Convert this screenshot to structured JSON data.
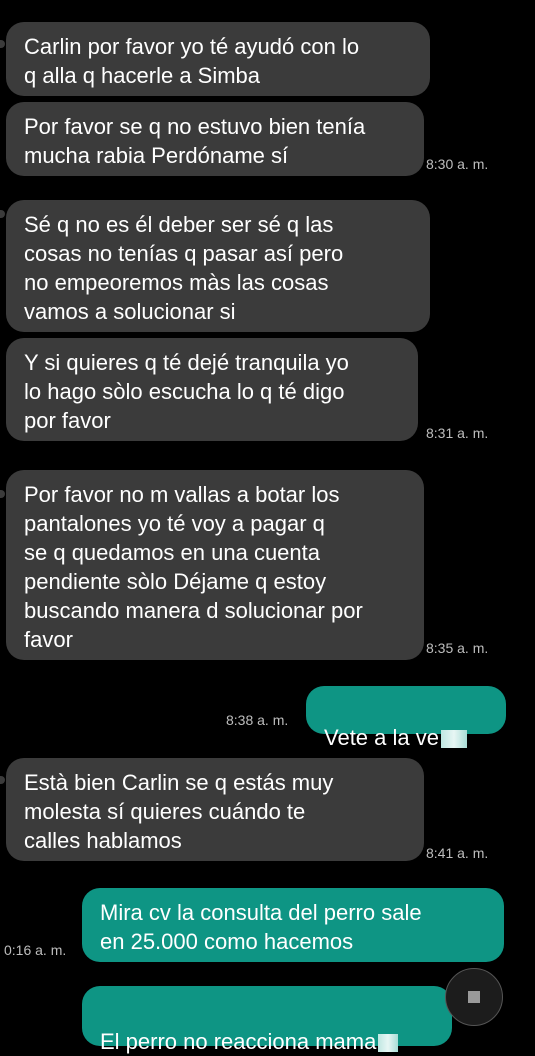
{
  "messages": [
    {
      "dir": "in",
      "text": "Carlin por favor yo té ayudó con lo\nq alla q hacerle a Simba"
    },
    {
      "dir": "in",
      "text": "Por favor se q no estuvo bien tenía\nmucha rabia Perdóname sí",
      "time": "8:30 a. m."
    },
    {
      "dir": "in",
      "text": "Sé q no es él deber ser sé q las\ncosas no tenías q pasar así pero\nno empeoremos màs las cosas\nvamos a solucionar si"
    },
    {
      "dir": "in",
      "text": "Y si quieres q té dejé tranquila yo\nlo hago sòlo escucha lo q té digo\npor favor",
      "time": "8:31 a. m."
    },
    {
      "dir": "in",
      "text": "Por favor no m vallas a botar los\npantalones yo té voy a pagar q\nse q quedamos en una cuenta\npendiente sòlo Déjame q estoy\nbuscando manera d solucionar por\nfavor",
      "time": "8:35 a. m."
    },
    {
      "dir": "out",
      "text": "Vete a la ve",
      "time": "8:38 a. m."
    },
    {
      "dir": "in",
      "text": "Està bien Carlin se q estás muy\nmolesta sí quieres cuándo te\ncalles hablamos",
      "time": "8:41 a. m."
    },
    {
      "dir": "out",
      "text": "Mira cv la consulta del perro sale\nen 25.000  como hacemos",
      "time": "0:16 a. m."
    },
    {
      "dir": "out",
      "text": "El perro no reacciona mama"
    }
  ]
}
